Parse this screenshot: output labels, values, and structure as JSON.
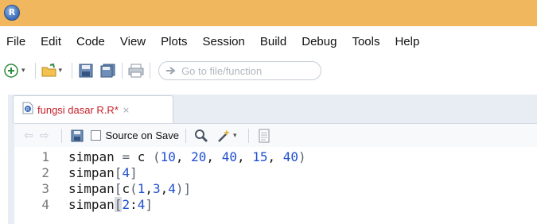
{
  "window": {
    "icon": "r-logo",
    "accent": "#f0b75e"
  },
  "menubar": {
    "items": [
      "File",
      "Edit",
      "Code",
      "View",
      "Plots",
      "Session",
      "Build",
      "Debug",
      "Tools",
      "Help"
    ]
  },
  "toolbar": {
    "goto_placeholder": "Go to file/function",
    "icons": [
      "new-file-icon",
      "open-folder-icon",
      "save-icon",
      "save-all-icon",
      "print-icon"
    ]
  },
  "editor": {
    "tab_label": "fungsi dasar R.R*",
    "tab_close": "×",
    "source_on_save_label": "Source on Save",
    "lines": [
      {
        "number": "1",
        "text": "simpan = c (10, 20, 40, 15, 40)"
      },
      {
        "number": "2",
        "text": "simpan[4]"
      },
      {
        "number": "3",
        "text": "simpan[c(1,3,4)]"
      },
      {
        "number": "4",
        "text": "simpan[2:4]"
      }
    ]
  }
}
